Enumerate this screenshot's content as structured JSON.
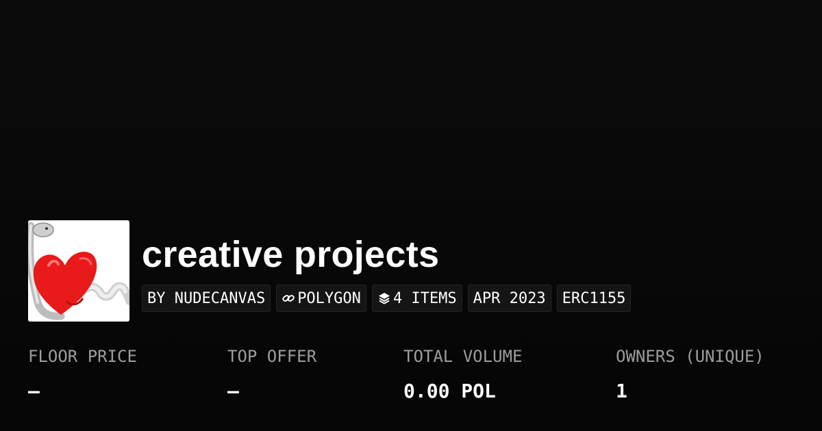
{
  "collection": {
    "title": "creative projects",
    "image_icon": "heart-snake-artwork-icon"
  },
  "chips": {
    "creator": "BY NUDECANVAS",
    "chain": "POLYGON",
    "chain_icon": "link-icon",
    "items": "4 ITEMS",
    "items_icon": "layers-icon",
    "date": "APR 2023",
    "standard": "ERC1155"
  },
  "stats": {
    "floor_price": {
      "label": "FLOOR PRICE",
      "value": "–"
    },
    "top_offer": {
      "label": "TOP OFFER",
      "value": "–"
    },
    "total_volume": {
      "label": "TOTAL VOLUME",
      "value": "0.00 POL"
    },
    "owners": {
      "label": "OWNERS (UNIQUE)",
      "value": "1"
    }
  },
  "colors": {
    "background": "#0a0a0a",
    "chip_background": "#151515",
    "label_gray": "#9d9d9d",
    "text": "#ffffff"
  }
}
